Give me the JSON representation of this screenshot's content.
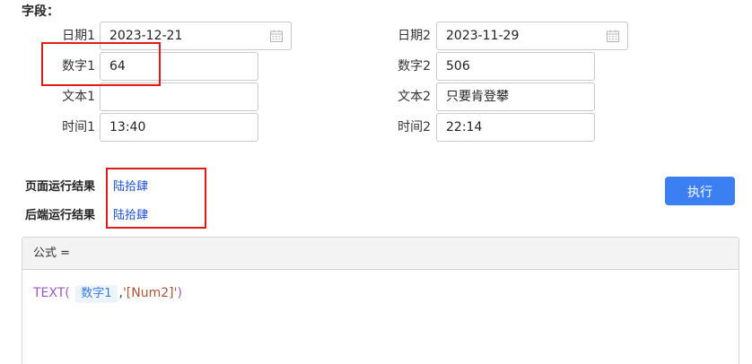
{
  "section": {
    "title": "字段："
  },
  "fields": {
    "date1": {
      "label": "日期1",
      "value": "2023-12-21",
      "icon": "calendar-icon"
    },
    "date2": {
      "label": "日期2",
      "value": "2023-11-29",
      "icon": "calendar-icon"
    },
    "num1": {
      "label": "数字1",
      "value": "64"
    },
    "num2": {
      "label": "数字2",
      "value": "506"
    },
    "text1": {
      "label": "文本1",
      "value": ""
    },
    "text2": {
      "label": "文本2",
      "value": "只要肯登攀"
    },
    "time1": {
      "label": "时间1",
      "value": "13:40"
    },
    "time2": {
      "label": "时间2",
      "value": "22:14"
    }
  },
  "results": {
    "page_label": "页面运行结果",
    "page_value": "陆拾肆",
    "backend_label": "后端运行结果",
    "backend_value": "陆拾肆"
  },
  "execute": {
    "label": "执行"
  },
  "formula": {
    "header": "公式 =",
    "function_name": "TEXT",
    "open_paren": "(",
    "field_chip": "数字1",
    "comma": ",",
    "argument": "'[Num2]'",
    "close_paren": ")"
  },
  "colors": {
    "highlight": "#e21a1a",
    "accent": "#3b7ff2",
    "result_text": "#1a4fd6",
    "function_color": "#9b59c7"
  }
}
